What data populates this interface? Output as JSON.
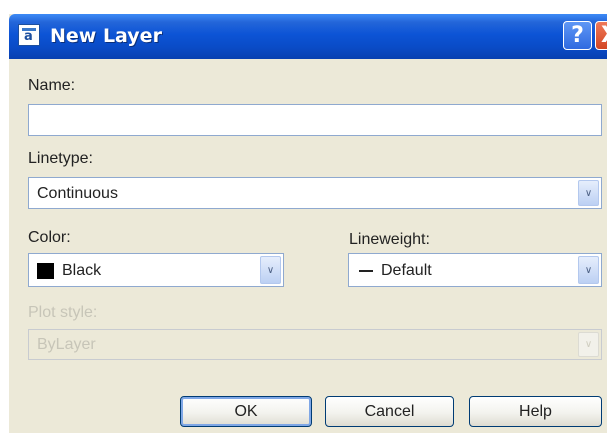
{
  "window": {
    "title": "New Layer"
  },
  "titlebar": {
    "icon": "app-icon",
    "help_glyph": "?",
    "close_glyph": "X"
  },
  "form": {
    "name_label": "Name:",
    "name_value": "",
    "linetype_label": "Linetype:",
    "linetype_value": "Continuous",
    "color_label": "Color:",
    "color_value": "Black",
    "color_swatch": "#000000",
    "lineweight_label": "Lineweight:",
    "lineweight_value": "Default",
    "plotstyle_label": "Plot style:",
    "plotstyle_value": "ByLayer"
  },
  "buttons": {
    "ok": "OK",
    "cancel": "Cancel",
    "help": "Help"
  },
  "colors": {
    "title_bar": "#0c54d6",
    "dialog_bg": "#ece9d8",
    "field_border": "#8fa9cf"
  }
}
